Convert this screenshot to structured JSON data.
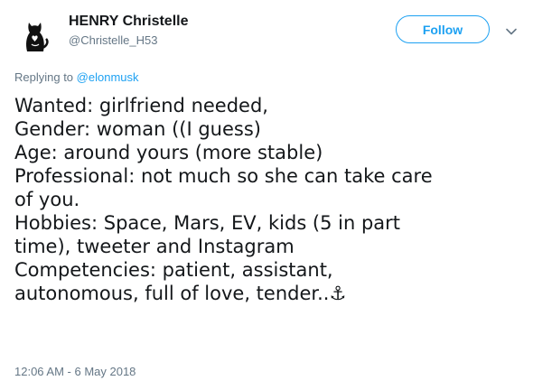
{
  "author": {
    "display_name": "HENRY Christelle",
    "handle": "@Christelle_H53",
    "avatar_icon": "cat-silhouette-avatar-icon"
  },
  "actions": {
    "follow_label": "Follow",
    "more_icon": "chevron-down-icon"
  },
  "reply": {
    "prefix": "Replying to",
    "to_handle": "@elonmusk"
  },
  "tweet": {
    "lines": [
      "Wanted: girlfriend needed,",
      "Gender: woman ((I guess)",
      "Age: around yours (more stable)",
      "Professional: not much so she can take care",
      "of you.",
      "Hobbies: Space, Mars, EV, kids (5 in part",
      "time), tweeter and Instagram",
      "Competencies: patient, assistant,",
      "autonomous, full of love, tender..⚓"
    ]
  },
  "meta": {
    "timestamp": "12:06 AM - 6 May 2018"
  },
  "colors": {
    "accent": "#1da1f2",
    "text": "#14171a",
    "muted": "#657786"
  }
}
